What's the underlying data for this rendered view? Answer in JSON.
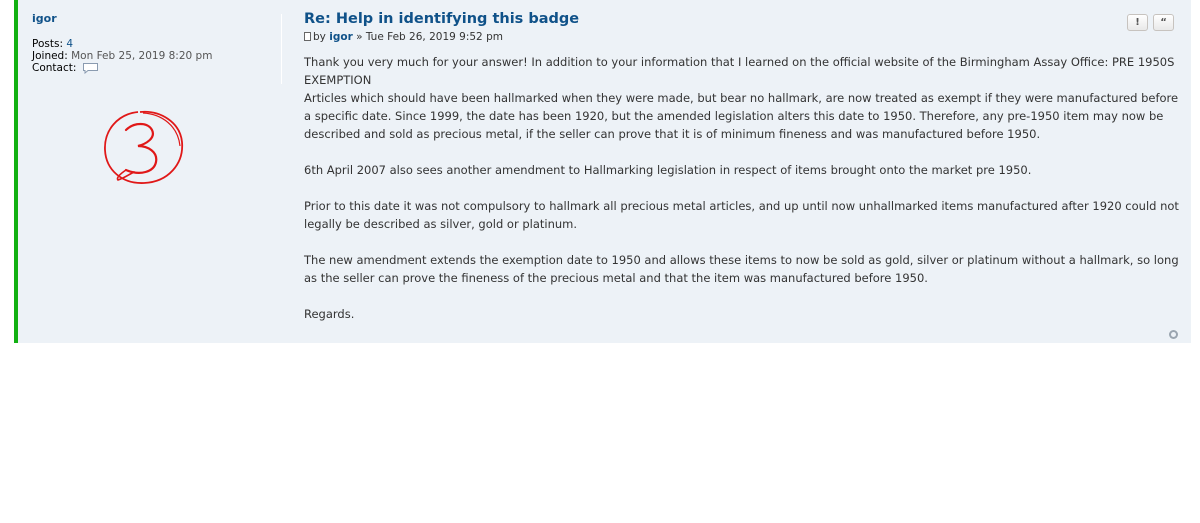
{
  "profile": {
    "username": "igor",
    "posts_label": "Posts:",
    "posts_value": "4",
    "joined_label": "Joined:",
    "joined_value": "Mon Feb 25, 2019 8:20 pm",
    "contact_label": "Contact:"
  },
  "post": {
    "title": "Re: Help in identifying this badge",
    "by": "by",
    "author": "igor",
    "date": "» Tue Feb 26, 2019 9:52 pm",
    "paragraphs": [
      "Thank you very much for your answer! In addition to your information that I learned on the official website of the Birmingham Assay Office: PRE 1950S EXEMPTION",
      "Articles which should have been hallmarked when they were made, but bear no hallmark, are now treated as exempt if they were manufactured before a specific date. Since 1999, the date has been 1920, but the amended legislation alters this date to 1950. Therefore, any pre-1950 item may now be described and sold as precious metal, if the seller can prove that it is of minimum fineness and was manufactured before 1950.",
      "6th April 2007 also sees another amendment to Hallmarking legislation in respect of items brought onto the market pre 1950.",
      "Prior to this date it was not compulsory to hallmark all precious metal articles, and up until now unhallmarked items manufactured after 1920 could not legally be described as silver, gold or platinum.",
      "The new amendment extends the exemption date to 1950 and allows these items to now be sold as gold, silver or platinum without a hallmark, so long as the seller can prove the fineness of the precious metal and that the item was manufactured before 1950.",
      "Regards."
    ]
  },
  "actions": {
    "report_label": "!",
    "quote_label": "“"
  },
  "annotation": {
    "text": "3",
    "color": "#e01818"
  },
  "colors": {
    "post_bg": "#edf2f7",
    "online_bar": "#12b012",
    "link": "#105289"
  }
}
